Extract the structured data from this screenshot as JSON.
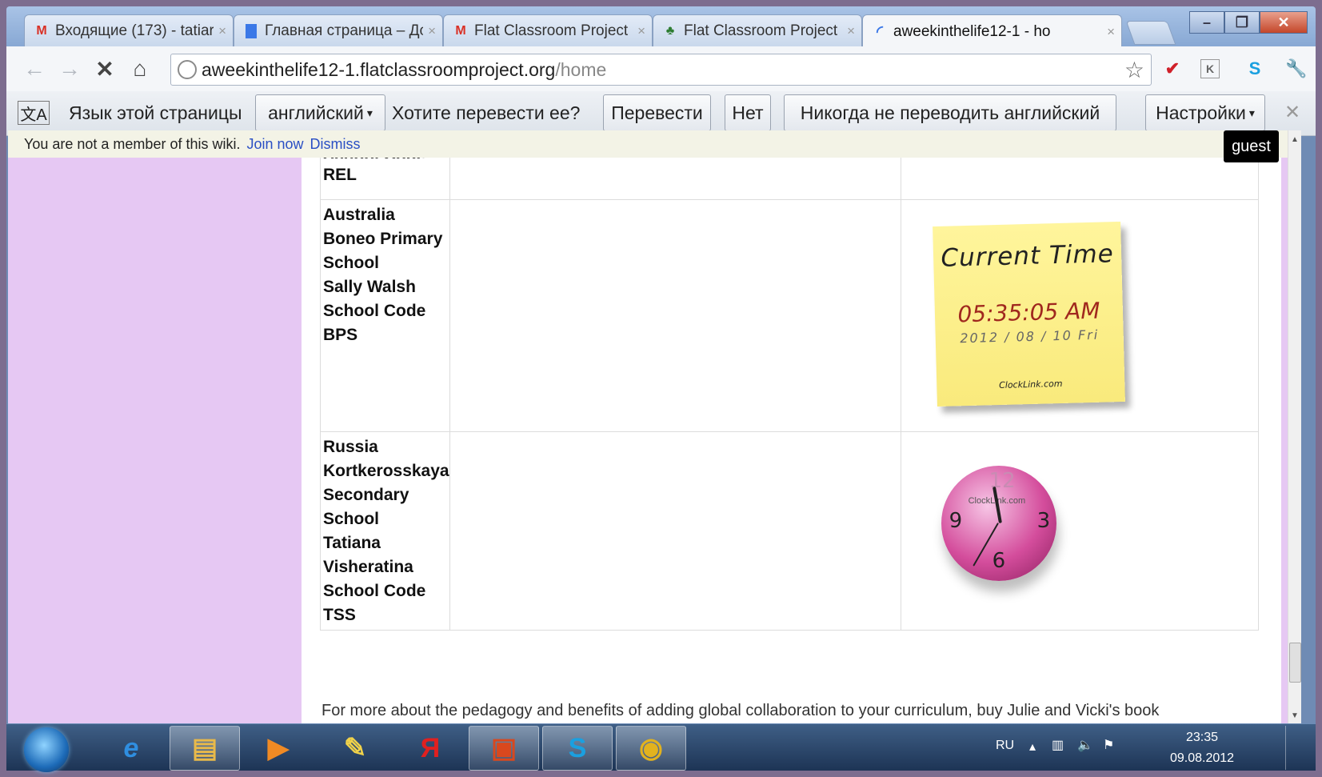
{
  "browser": {
    "tabs": [
      {
        "title": "Входящие (173) - tatiar",
        "icon": "gmail-icon"
      },
      {
        "title": "Главная страница – Дс",
        "icon": "docs-icon"
      },
      {
        "title": "Flat Classroom Project |",
        "icon": "gmail-icon"
      },
      {
        "title": "Flat Classroom Project",
        "icon": "plant-icon"
      },
      {
        "title": "aweekinthelife12-1 - ho",
        "icon": "loading-icon"
      }
    ],
    "url_host": "aweekinthelife12-1.flatclassroomproject.org",
    "url_path": "/home"
  },
  "translate_bar": {
    "label": "Язык этой страницы",
    "language": "английский",
    "question": "Хотите перевести ее?",
    "translate_btn": "Перевести",
    "no_btn": "Нет",
    "never_btn": "Никогда не переводить английский",
    "settings_btn": "Настройки"
  },
  "notice": {
    "text": "You are not a member of this wiki.",
    "join": "Join now",
    "dismiss": "Dismiss",
    "user": "guest"
  },
  "table": {
    "row0": {
      "cut": "School Code",
      "code": "REL"
    },
    "row1": {
      "country": "Australia",
      "school": "Boneo Primary",
      "school2": "School",
      "teacher": "Sally Walsh",
      "code_label": "School Code",
      "code": "BPS"
    },
    "row2": {
      "country": "Russia",
      "school": "Kortkerosskaya",
      "school2": "Secondary",
      "school3": "School",
      "teacher1": "Tatiana",
      "teacher2": "Visheratina",
      "code_label": "School Code",
      "code": "TSS"
    }
  },
  "sticky_clock": {
    "title": "Current Time",
    "time": "05:35:05 AM",
    "date": "2012 / 08 / 10 Fri",
    "source": "ClockLink.com"
  },
  "analog_clock": {
    "brand": "ClockLink.com",
    "n12": "12",
    "n3": "3",
    "n6": "6",
    "n9": "9"
  },
  "footer_text": "For more about the pedagogy and benefits of adding global collaboration to your curriculum, buy Julie and Vicki's book",
  "taskbar": {
    "lang": "RU",
    "time": "23:35",
    "date": "09.08.2012"
  },
  "colors": {
    "page_bg": "#e6c8f3",
    "link": "#2a4fc4",
    "sticky": "#fff59c",
    "time_red": "#a0281e"
  }
}
